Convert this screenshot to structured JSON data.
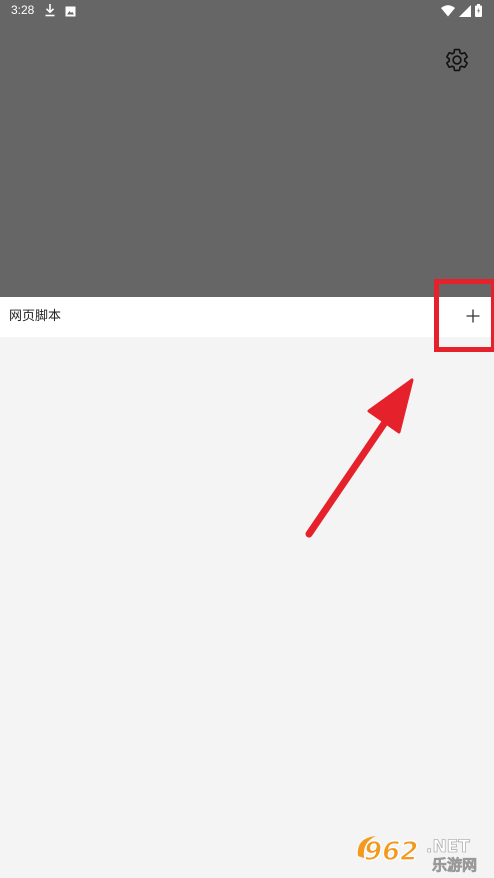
{
  "status_bar": {
    "time": "3:28",
    "left_icons": [
      "download-icon",
      "image-notification-icon"
    ],
    "right_icons": [
      "wifi-icon",
      "signal-icon",
      "battery-icon"
    ]
  },
  "header": {
    "background_color": "#666666",
    "settings_icon": "gear-icon"
  },
  "row": {
    "label": "网页脚本",
    "add_icon": "plus-icon"
  },
  "annotations": {
    "highlight_color": "#e5222b",
    "arrow_color": "#e5222b"
  },
  "watermark": {
    "number": "962",
    "domain": ".NET",
    "caption": "乐游网"
  },
  "colors": {
    "content_background": "#f4f4f4"
  }
}
